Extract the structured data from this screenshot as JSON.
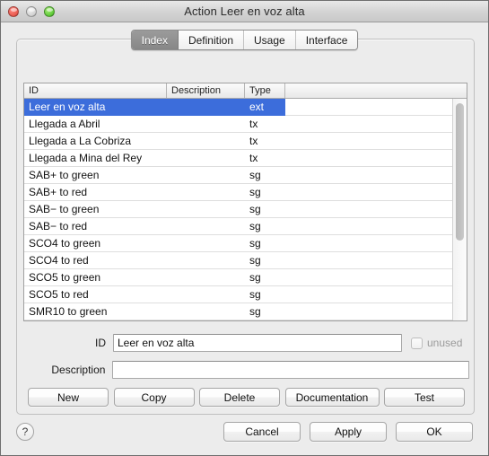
{
  "window": {
    "title": "Action Leer en voz alta",
    "traffic_lights": [
      {
        "name": "close",
        "color": "#e8584d"
      },
      {
        "name": "minimize",
        "color": "#d0d0d0"
      },
      {
        "name": "zoom",
        "color": "#5cc936"
      }
    ]
  },
  "tabs": [
    {
      "label": "Index",
      "active": true
    },
    {
      "label": "Definition",
      "active": false
    },
    {
      "label": "Usage",
      "active": false
    },
    {
      "label": "Interface",
      "active": false
    }
  ],
  "table": {
    "columns": [
      "ID",
      "Description",
      "Type",
      ""
    ],
    "selection_color": "#3c6ddb",
    "rows": [
      {
        "id": "Leer en voz alta",
        "description": "",
        "type": "ext",
        "extra": "",
        "selected": true
      },
      {
        "id": "Llegada a Abril",
        "description": "",
        "type": "tx",
        "extra": "",
        "selected": false
      },
      {
        "id": "Llegada a La Cobriza",
        "description": "",
        "type": "tx",
        "extra": "",
        "selected": false
      },
      {
        "id": "Llegada a Mina del Rey",
        "description": "",
        "type": "tx",
        "extra": "",
        "selected": false
      },
      {
        "id": "SAB+ to green",
        "description": "",
        "type": "sg",
        "extra": "",
        "selected": false
      },
      {
        "id": "SAB+ to red",
        "description": "",
        "type": "sg",
        "extra": "",
        "selected": false
      },
      {
        "id": "SAB− to green",
        "description": "",
        "type": "sg",
        "extra": "",
        "selected": false
      },
      {
        "id": "SAB− to red",
        "description": "",
        "type": "sg",
        "extra": "",
        "selected": false
      },
      {
        "id": "SCO4 to green",
        "description": "",
        "type": "sg",
        "extra": "",
        "selected": false
      },
      {
        "id": "SCO4 to red",
        "description": "",
        "type": "sg",
        "extra": "",
        "selected": false
      },
      {
        "id": "SCO5 to green",
        "description": "",
        "type": "sg",
        "extra": "",
        "selected": false
      },
      {
        "id": "SCO5 to red",
        "description": "",
        "type": "sg",
        "extra": "",
        "selected": false
      },
      {
        "id": "SMR10 to green",
        "description": "",
        "type": "sg",
        "extra": "",
        "selected": false
      }
    ]
  },
  "form": {
    "id_label": "ID",
    "id_value": "Leer en voz alta",
    "id_placeholder": "",
    "description_label": "Description",
    "description_value": "",
    "description_placeholder": "",
    "unused_label": "unused",
    "unused_checked": false,
    "unused_disabled": true
  },
  "actions": {
    "new": "New",
    "copy": "Copy",
    "delete": "Delete",
    "documentation": "Documentation",
    "test": "Test"
  },
  "footer": {
    "help": "?",
    "cancel": "Cancel",
    "apply": "Apply",
    "ok": "OK"
  }
}
